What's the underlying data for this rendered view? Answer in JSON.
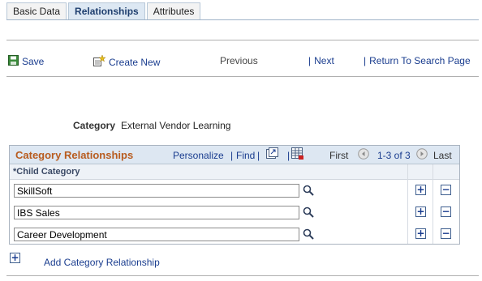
{
  "tabs": [
    {
      "label": "Basic Data",
      "active": false
    },
    {
      "label": "Relationships",
      "active": true
    },
    {
      "label": "Attributes",
      "active": false
    }
  ],
  "toolbar": {
    "save": "Save",
    "create_new": "Create New",
    "previous": "Previous",
    "next": "Next",
    "return_to_search": "Return To Search Page"
  },
  "category": {
    "label": "Category",
    "value": "External Vendor Learning"
  },
  "grid": {
    "title": "Category Relationships",
    "personalize": "Personalize",
    "find": "Find",
    "first": "First",
    "range": "1-3 of 3",
    "last": "Last",
    "column_header": "*Child Category",
    "rows": [
      {
        "value": "SkillSoft"
      },
      {
        "value": "IBS Sales"
      },
      {
        "value": "Career Development"
      }
    ]
  },
  "add_relationship": "Add Category Relationship",
  "colors": {
    "link": "#1a3d8f",
    "grid_title": "#b85c1f",
    "header_bg": "#dde7f2"
  }
}
